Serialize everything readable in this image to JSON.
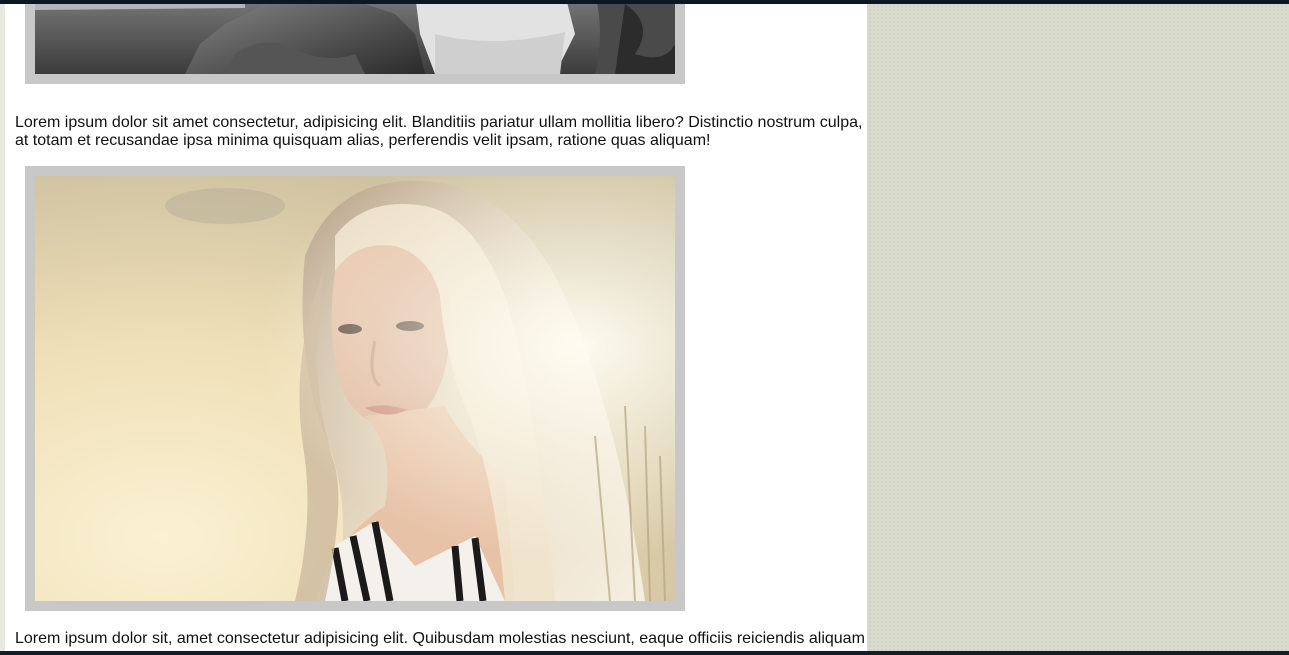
{
  "article": {
    "paragraph_1": "Lorem ipsum dolor sit amet consectetur, adipisicing elit. Blanditiis pariatur ullam mollitia libero? Distinctio nostrum culpa, at totam et recusandae ipsa minima quisquam alias, perferendis velit ipsam, ratione quas aliquam!",
    "paragraph_2": "Lorem ipsum dolor sit, amet consectetur adipisicing elit. Quibusdam molestias nesciunt, eaque officiis reiciendis aliquam"
  },
  "images": [
    {
      "name": "grayscale-seaside-photo",
      "style": "black-and-white"
    },
    {
      "name": "blonde-woman-portrait-photo",
      "style": "warm sunlit color"
    }
  ],
  "colors": {
    "frame": "#c8c8c8",
    "sidebar_background": "#d8dacb",
    "content_background": "#ffffff",
    "text": "#111111"
  }
}
